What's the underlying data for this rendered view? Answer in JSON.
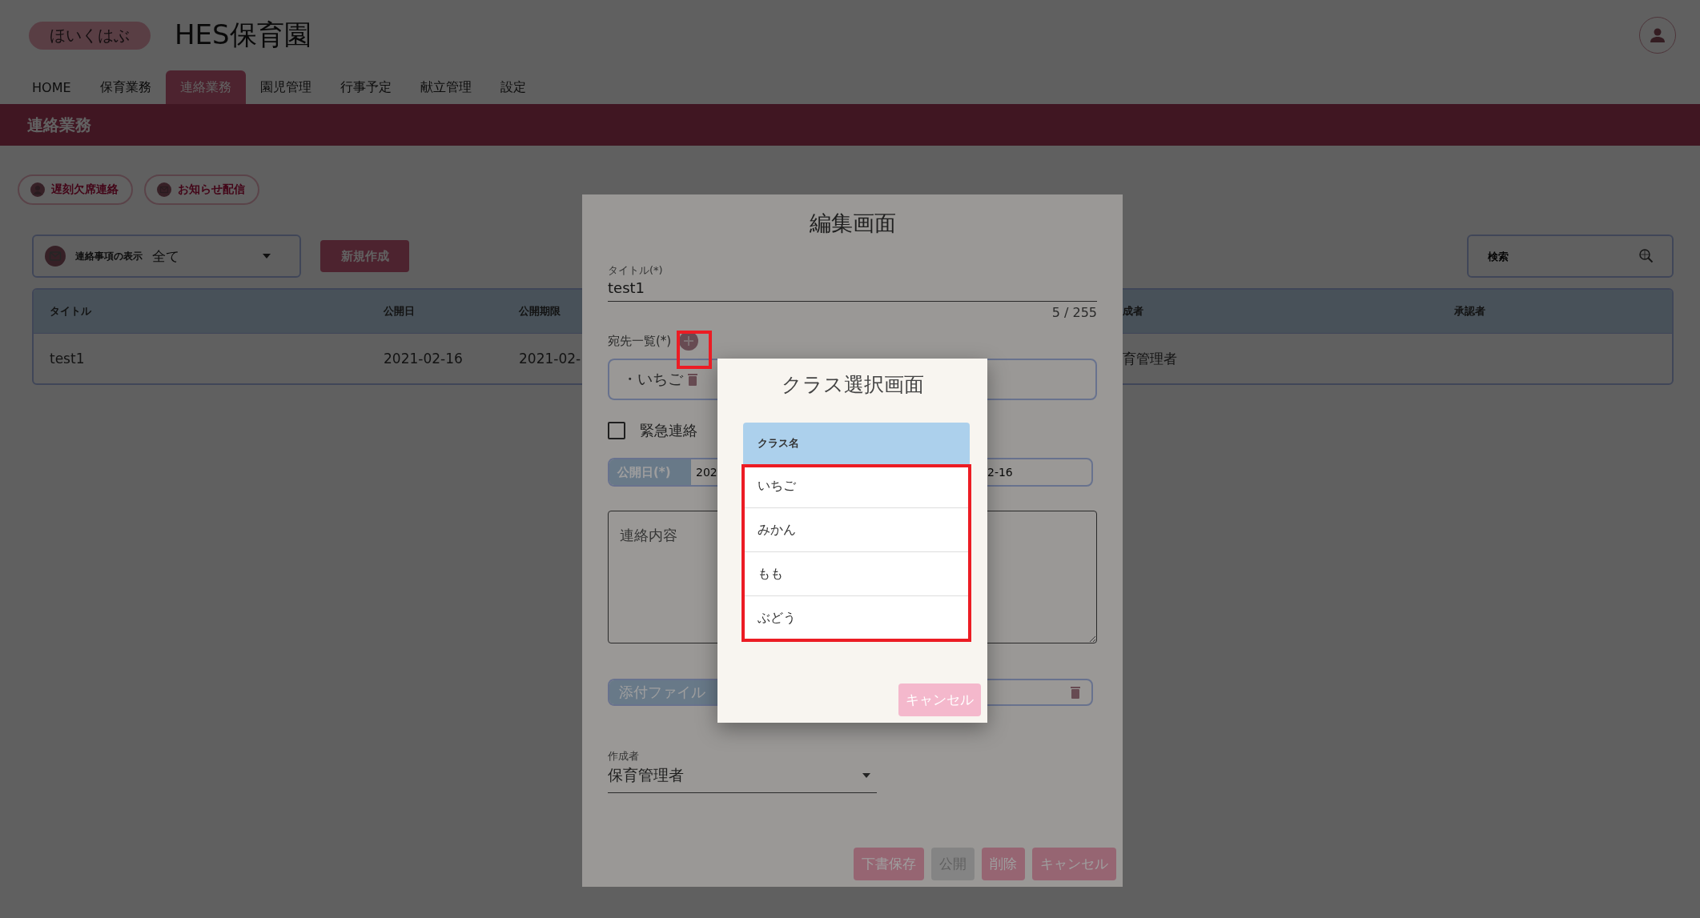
{
  "header": {
    "logo": "ほいくはぶ",
    "title": "HES保育園"
  },
  "nav_tabs": [
    {
      "label": "HOME",
      "selected": false
    },
    {
      "label": "保育業務",
      "selected": false
    },
    {
      "label": "連絡業務",
      "selected": true
    },
    {
      "label": "園児管理",
      "selected": false
    },
    {
      "label": "行事予定",
      "selected": false
    },
    {
      "label": "献立管理",
      "selected": false
    },
    {
      "label": "設定",
      "selected": false
    }
  ],
  "page_title": "連絡業務",
  "quick_buttons": [
    {
      "label": "遅刻欠席連絡",
      "kind": "person"
    },
    {
      "label": "お知らせ配信",
      "kind": "mail"
    }
  ],
  "filter": {
    "label": "連絡事項の表示",
    "value": "全て"
  },
  "new_button": "新規作成",
  "search": {
    "placeholder": "検索"
  },
  "table": {
    "columns": [
      "タイトル",
      "公開日",
      "公開期限",
      "成者",
      "承認者"
    ],
    "rows": [
      [
        "test1",
        "2021-02-16",
        "2021-02-",
        "育管理者"
      ]
    ]
  },
  "edit_dialog": {
    "title": "編集画面",
    "title_field": {
      "label": "タイトル(*)",
      "value": "test1",
      "counter": "5 / 255"
    },
    "recipients": {
      "label": "宛先一覧(*)",
      "items": [
        "・いちご"
      ]
    },
    "urgent": {
      "label": "緊急連絡",
      "checked": false
    },
    "publish_date": {
      "label": "公開日(*)",
      "value_start": "202",
      "value_end": "2-16"
    },
    "body": {
      "placeholder": "連絡内容"
    },
    "attachment": {
      "label": "添付ファイル"
    },
    "author": {
      "label": "作成者",
      "value": "保育管理者"
    },
    "buttons": [
      {
        "label": "下書保存",
        "disabled": false
      },
      {
        "label": "公開",
        "disabled": true
      },
      {
        "label": "削除",
        "disabled": false
      },
      {
        "label": "キャンセル",
        "disabled": false
      }
    ]
  },
  "class_dialog": {
    "title": "クラス選択画面",
    "column": "クラス名",
    "rows": [
      "いちご",
      "みかん",
      "もも",
      "ぶどう"
    ],
    "cancel": "キャンセル"
  }
}
